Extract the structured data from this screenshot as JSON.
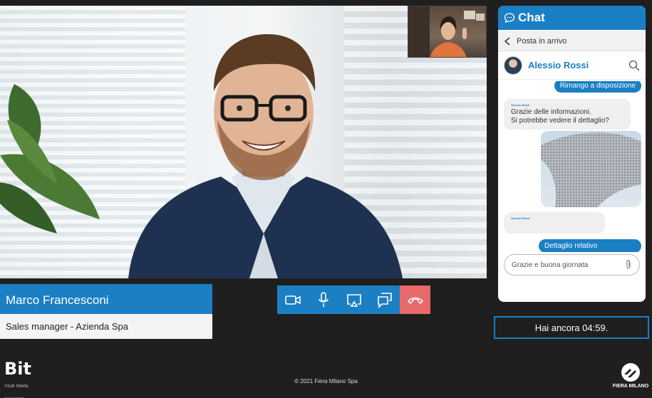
{
  "participant": {
    "name": "Marco Francesconi",
    "role": "Sales manager - Azienda Spa"
  },
  "controls": {
    "camera_icon": "video-camera-icon",
    "mic_icon": "microphone-icon",
    "share_icon": "screen-share-icon",
    "chat_icon": "chat-bubbles-icon",
    "end_icon": "hang-up-icon"
  },
  "chat": {
    "title": "Chat",
    "inbox_label": "Posta in arrivo",
    "contact_name": "Alessio Rossi",
    "messages": [
      {
        "direction": "out",
        "text": "Rimango a disposizione"
      },
      {
        "direction": "in",
        "sender": "Alessio Rossi",
        "text_line1": "Grazie delle informazioni.",
        "text_line2": "Si potrebbe vedere il dettaglio?"
      },
      {
        "direction": "out",
        "type": "image"
      },
      {
        "direction": "in",
        "sender": "Alessio Rossi",
        "text_line1": ""
      },
      {
        "direction": "out",
        "text": "Dettaglio relativo"
      }
    ],
    "input_value": "Grazie e buona giornata"
  },
  "timer": "Hai ancora 04:59.",
  "footer": {
    "left_logo": "Bit",
    "left_logo_sub": "YOUR TRAVEL EXHIBITION",
    "copyright": "© 2021 Fiera Milano Spa",
    "right_logo": "FIERA MILANO"
  },
  "colors": {
    "accent": "#1b7fc4",
    "end_call": "#e86a6a",
    "background": "#1f1f1f"
  }
}
